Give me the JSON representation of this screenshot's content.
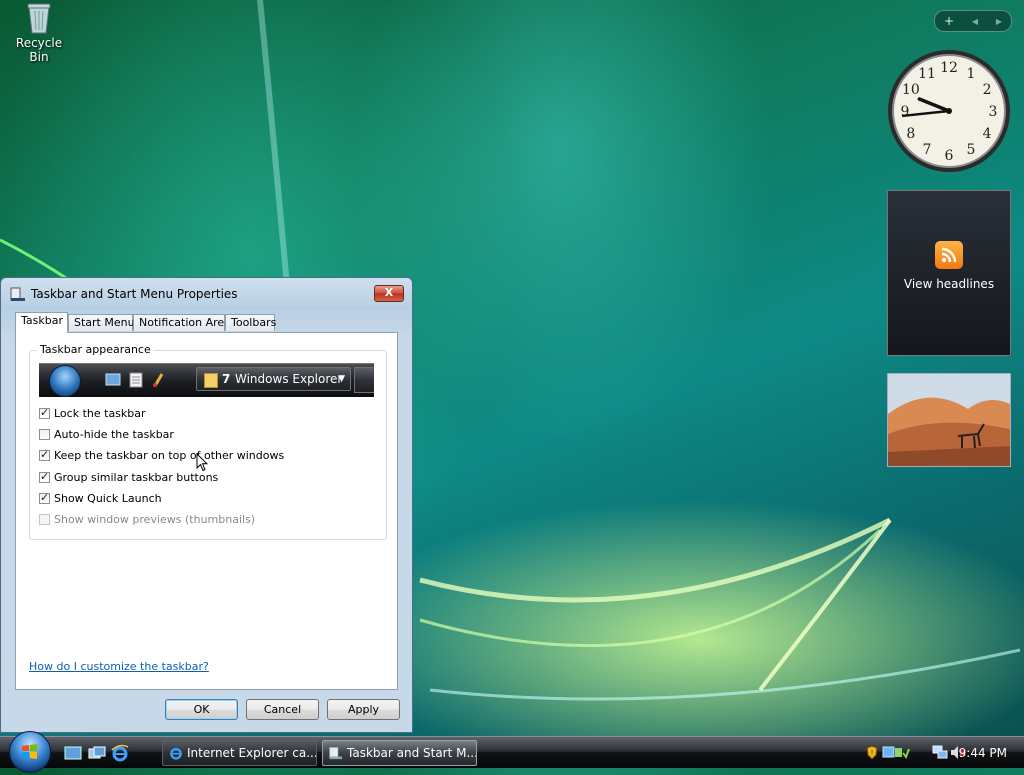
{
  "desktop": {
    "recycle_bin_label": "Recycle Bin"
  },
  "sidebar": {
    "add_symbol": "+",
    "prev_symbol": "◀",
    "next_symbol": "▶",
    "clock_numbers": [
      "12",
      "1",
      "2",
      "3",
      "4",
      "5",
      "6",
      "7",
      "8",
      "9",
      "10",
      "11"
    ],
    "clock_time": "9:44",
    "feed_label": "View headlines"
  },
  "dialog": {
    "title": "Taskbar and Start Menu Properties",
    "close_symbol": "X",
    "tabs": [
      {
        "label": "Taskbar"
      },
      {
        "label": "Start Menu"
      },
      {
        "label": "Notification Area"
      },
      {
        "label": "Toolbars"
      }
    ],
    "group_label": "Taskbar appearance",
    "preview": {
      "button_count": "7",
      "button_label": "Windows Explorer",
      "arrow": "▼"
    },
    "options": [
      {
        "label": "Lock the taskbar",
        "checked": true,
        "enabled": true
      },
      {
        "label": "Auto-hide the taskbar",
        "checked": false,
        "enabled": true
      },
      {
        "label": "Keep the taskbar on top of other windows",
        "checked": true,
        "enabled": true
      },
      {
        "label": "Group similar taskbar buttons",
        "checked": true,
        "enabled": true
      },
      {
        "label": "Show Quick Launch",
        "checked": true,
        "enabled": true
      },
      {
        "label": "Show window previews (thumbnails)",
        "checked": false,
        "enabled": false
      }
    ],
    "help_link": "How do I customize the taskbar?",
    "ok_label": "OK",
    "cancel_label": "Cancel",
    "apply_label": "Apply"
  },
  "taskbar": {
    "tasks": [
      {
        "label": "Internet Explorer ca...",
        "active": false
      },
      {
        "label": "Taskbar and Start M...",
        "active": true
      }
    ],
    "time": "9:44 PM"
  },
  "colors": {
    "link": "#0b5fb5",
    "close_button": "#c74a36",
    "rss": "#f07a10"
  }
}
